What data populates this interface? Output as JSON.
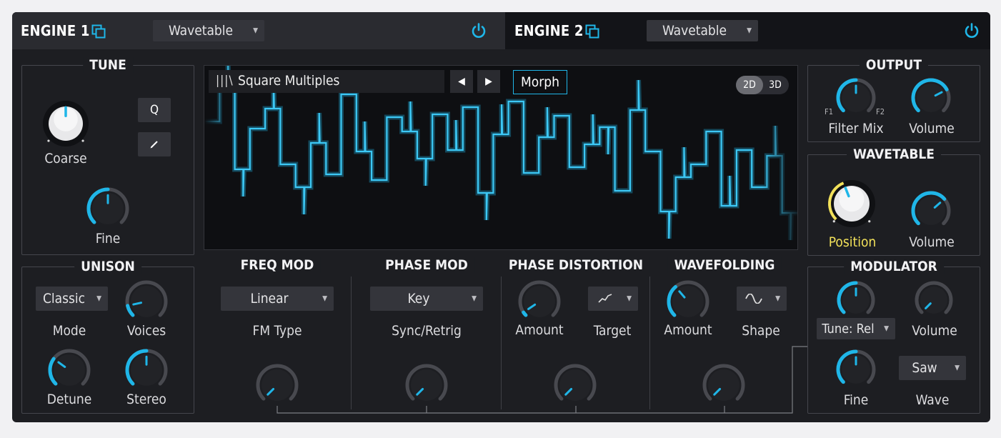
{
  "engine1": {
    "title": "ENGINE 1",
    "type": "Wavetable"
  },
  "engine2": {
    "title": "ENGINE 2",
    "type": "Wavetable"
  },
  "tune": {
    "title": "TUNE",
    "coarse": "Coarse",
    "fine": "Fine",
    "q": "Q"
  },
  "unison": {
    "title": "UNISON",
    "mode_value": "Classic",
    "mode": "Mode",
    "voices": "Voices",
    "detune": "Detune",
    "stereo": "Stereo"
  },
  "wavetable_display": {
    "table_icon": "|||\\",
    "table_name": "Square Multiples",
    "morph": "Morph",
    "opt_2d": "2D",
    "opt_3d": "3D"
  },
  "freq_mod": {
    "title": "FREQ MOD",
    "type_value": "Linear",
    "type_label": "FM Type"
  },
  "phase_mod": {
    "title": "PHASE MOD",
    "value": "Key",
    "label": "Sync/Retrig"
  },
  "phase_distortion": {
    "title": "PHASE DISTORTION",
    "amount": "Amount",
    "target": "Target"
  },
  "wavefolding": {
    "title": "WAVEFOLDING",
    "amount": "Amount",
    "shape": "Shape"
  },
  "output": {
    "title": "OUTPUT",
    "f1": "F1",
    "f2": "F2",
    "filter_mix": "Filter Mix",
    "volume": "Volume"
  },
  "wavetable": {
    "title": "WAVETABLE",
    "position": "Position",
    "volume": "Volume"
  },
  "modulator": {
    "title": "MODULATOR",
    "tune_value": "Tune: Rel",
    "volume": "Volume",
    "fine": "Fine",
    "wave_value": "Saw",
    "wave": "Wave"
  },
  "colors": {
    "accent": "#1fb6e8",
    "position": "#f2e15a"
  },
  "knobs": {
    "coarse": 0.5,
    "fine": 0.5,
    "voices": 0.12,
    "detune": 0.3,
    "stereo": 0.5,
    "fm_amount": 0.0,
    "pm_amount": 0.0,
    "pd_amount": 0.04,
    "pd_mod": 0.0,
    "wf_amount": 0.35,
    "wf_mod": 0.0,
    "filter_mix": 0.5,
    "out_volume": 0.73,
    "position": 0.42,
    "wt_volume": 0.68,
    "mod_tune": 0.5,
    "mod_volume": 0.0,
    "mod_fine": 0.5
  }
}
